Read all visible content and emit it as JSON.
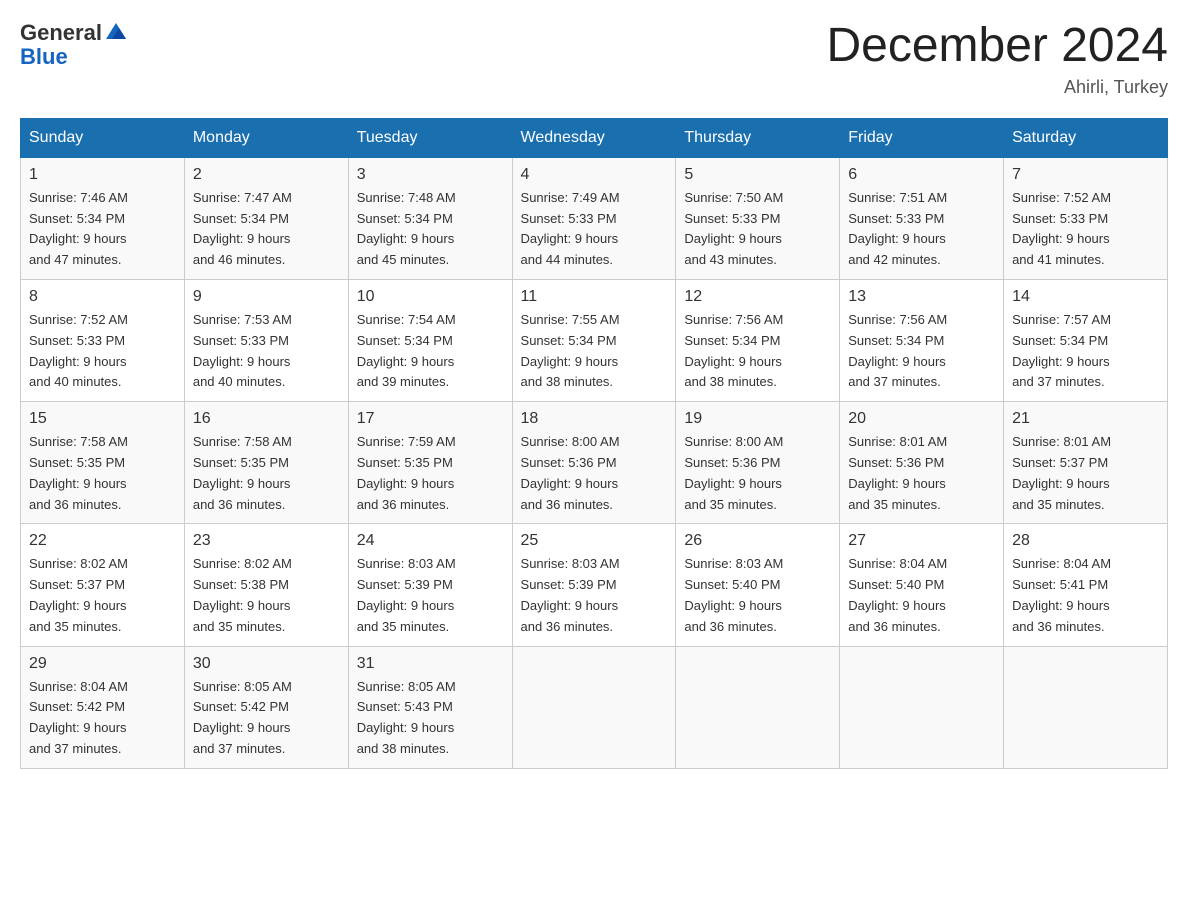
{
  "header": {
    "logo_line1": "General",
    "logo_line2": "Blue",
    "month_title": "December 2024",
    "location": "Ahirli, Turkey"
  },
  "days_of_week": [
    "Sunday",
    "Monday",
    "Tuesday",
    "Wednesday",
    "Thursday",
    "Friday",
    "Saturday"
  ],
  "weeks": [
    [
      {
        "day": "1",
        "sunrise": "7:46 AM",
        "sunset": "5:34 PM",
        "daylight": "9 hours and 47 minutes."
      },
      {
        "day": "2",
        "sunrise": "7:47 AM",
        "sunset": "5:34 PM",
        "daylight": "9 hours and 46 minutes."
      },
      {
        "day": "3",
        "sunrise": "7:48 AM",
        "sunset": "5:34 PM",
        "daylight": "9 hours and 45 minutes."
      },
      {
        "day": "4",
        "sunrise": "7:49 AM",
        "sunset": "5:33 PM",
        "daylight": "9 hours and 44 minutes."
      },
      {
        "day": "5",
        "sunrise": "7:50 AM",
        "sunset": "5:33 PM",
        "daylight": "9 hours and 43 minutes."
      },
      {
        "day": "6",
        "sunrise": "7:51 AM",
        "sunset": "5:33 PM",
        "daylight": "9 hours and 42 minutes."
      },
      {
        "day": "7",
        "sunrise": "7:52 AM",
        "sunset": "5:33 PM",
        "daylight": "9 hours and 41 minutes."
      }
    ],
    [
      {
        "day": "8",
        "sunrise": "7:52 AM",
        "sunset": "5:33 PM",
        "daylight": "9 hours and 40 minutes."
      },
      {
        "day": "9",
        "sunrise": "7:53 AM",
        "sunset": "5:33 PM",
        "daylight": "9 hours and 40 minutes."
      },
      {
        "day": "10",
        "sunrise": "7:54 AM",
        "sunset": "5:34 PM",
        "daylight": "9 hours and 39 minutes."
      },
      {
        "day": "11",
        "sunrise": "7:55 AM",
        "sunset": "5:34 PM",
        "daylight": "9 hours and 38 minutes."
      },
      {
        "day": "12",
        "sunrise": "7:56 AM",
        "sunset": "5:34 PM",
        "daylight": "9 hours and 38 minutes."
      },
      {
        "day": "13",
        "sunrise": "7:56 AM",
        "sunset": "5:34 PM",
        "daylight": "9 hours and 37 minutes."
      },
      {
        "day": "14",
        "sunrise": "7:57 AM",
        "sunset": "5:34 PM",
        "daylight": "9 hours and 37 minutes."
      }
    ],
    [
      {
        "day": "15",
        "sunrise": "7:58 AM",
        "sunset": "5:35 PM",
        "daylight": "9 hours and 36 minutes."
      },
      {
        "day": "16",
        "sunrise": "7:58 AM",
        "sunset": "5:35 PM",
        "daylight": "9 hours and 36 minutes."
      },
      {
        "day": "17",
        "sunrise": "7:59 AM",
        "sunset": "5:35 PM",
        "daylight": "9 hours and 36 minutes."
      },
      {
        "day": "18",
        "sunrise": "8:00 AM",
        "sunset": "5:36 PM",
        "daylight": "9 hours and 36 minutes."
      },
      {
        "day": "19",
        "sunrise": "8:00 AM",
        "sunset": "5:36 PM",
        "daylight": "9 hours and 35 minutes."
      },
      {
        "day": "20",
        "sunrise": "8:01 AM",
        "sunset": "5:36 PM",
        "daylight": "9 hours and 35 minutes."
      },
      {
        "day": "21",
        "sunrise": "8:01 AM",
        "sunset": "5:37 PM",
        "daylight": "9 hours and 35 minutes."
      }
    ],
    [
      {
        "day": "22",
        "sunrise": "8:02 AM",
        "sunset": "5:37 PM",
        "daylight": "9 hours and 35 minutes."
      },
      {
        "day": "23",
        "sunrise": "8:02 AM",
        "sunset": "5:38 PM",
        "daylight": "9 hours and 35 minutes."
      },
      {
        "day": "24",
        "sunrise": "8:03 AM",
        "sunset": "5:39 PM",
        "daylight": "9 hours and 35 minutes."
      },
      {
        "day": "25",
        "sunrise": "8:03 AM",
        "sunset": "5:39 PM",
        "daylight": "9 hours and 36 minutes."
      },
      {
        "day": "26",
        "sunrise": "8:03 AM",
        "sunset": "5:40 PM",
        "daylight": "9 hours and 36 minutes."
      },
      {
        "day": "27",
        "sunrise": "8:04 AM",
        "sunset": "5:40 PM",
        "daylight": "9 hours and 36 minutes."
      },
      {
        "day": "28",
        "sunrise": "8:04 AM",
        "sunset": "5:41 PM",
        "daylight": "9 hours and 36 minutes."
      }
    ],
    [
      {
        "day": "29",
        "sunrise": "8:04 AM",
        "sunset": "5:42 PM",
        "daylight": "9 hours and 37 minutes."
      },
      {
        "day": "30",
        "sunrise": "8:05 AM",
        "sunset": "5:42 PM",
        "daylight": "9 hours and 37 minutes."
      },
      {
        "day": "31",
        "sunrise": "8:05 AM",
        "sunset": "5:43 PM",
        "daylight": "9 hours and 38 minutes."
      },
      null,
      null,
      null,
      null
    ]
  ],
  "labels": {
    "sunrise": "Sunrise:",
    "sunset": "Sunset:",
    "daylight": "Daylight:"
  },
  "accent_color": "#1a6faf"
}
